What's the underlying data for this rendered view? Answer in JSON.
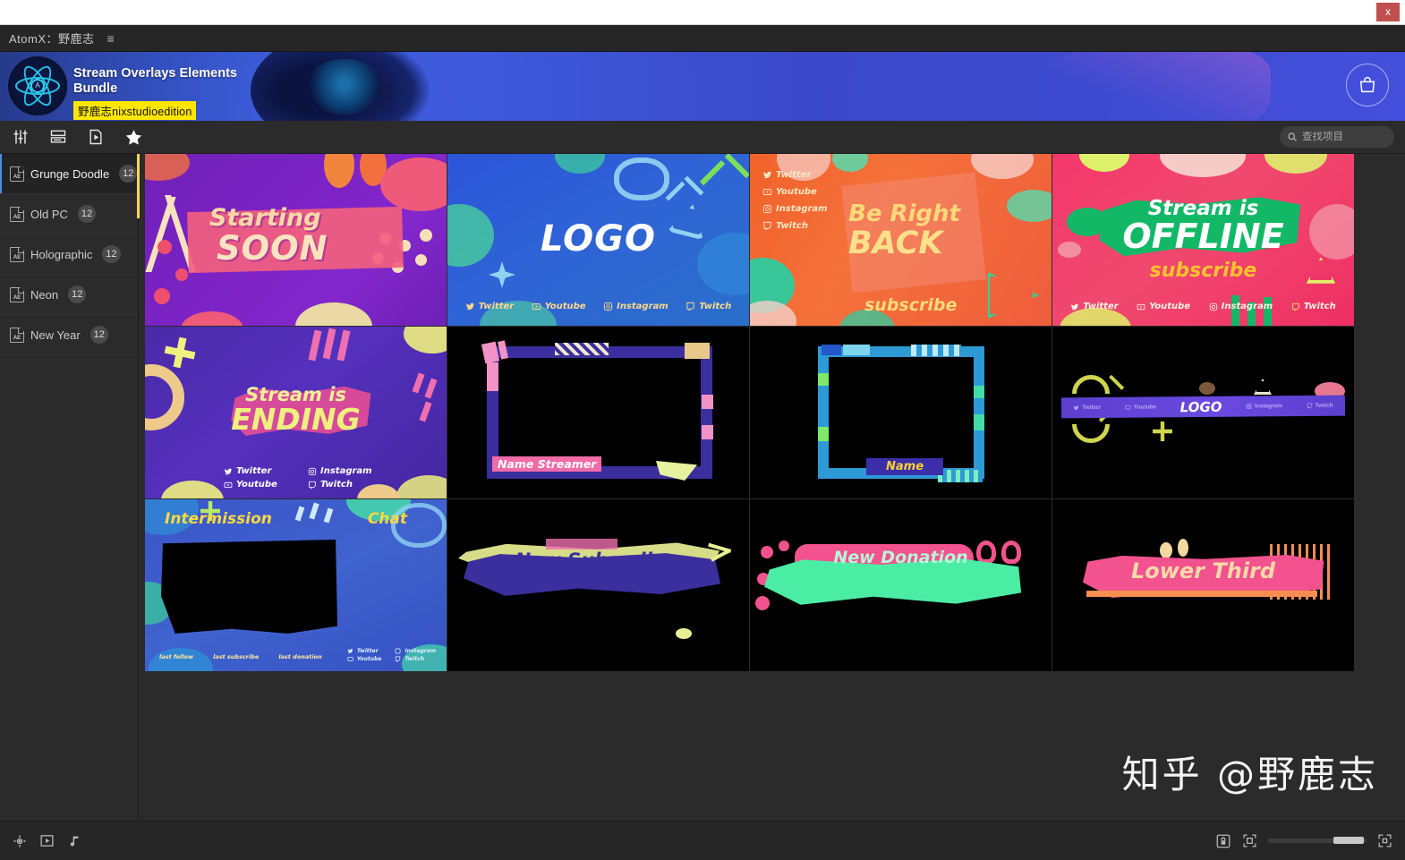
{
  "window": {
    "close_label": "x"
  },
  "menubar": {
    "title": "AtomX：野鹿志",
    "hamburger": "≡"
  },
  "hero": {
    "title": "Stream Overlays Elements Bundle",
    "tag": "野鹿志nixstudioedition",
    "logo_letter": "A",
    "cart_icon": "shopping-bag-icon"
  },
  "toolbar": {
    "icons": [
      "sliders-icon",
      "layers-icon",
      "file-play-icon",
      "star-icon"
    ]
  },
  "search": {
    "placeholder": "查找项目",
    "value": "",
    "icon": "search-icon"
  },
  "sidebar": {
    "items": [
      {
        "label": "Grunge Doodle",
        "count": "12",
        "icon": "ae-file-icon",
        "active": true
      },
      {
        "label": "Old PC",
        "count": "12",
        "icon": "ae-file-icon",
        "active": false
      },
      {
        "label": "Holographic",
        "count": "12",
        "icon": "ae-file-icon",
        "active": false
      },
      {
        "label": "Neon",
        "count": "12",
        "icon": "ae-file-icon",
        "active": false
      },
      {
        "label": "New Year",
        "count": "12",
        "icon": "ae-file-icon",
        "active": false
      }
    ]
  },
  "grid": {
    "tiles": [
      {
        "name": "starting-soon",
        "line1": "Starting",
        "line2": "SOON"
      },
      {
        "name": "logo-blue",
        "logo": "LOGO",
        "socials": [
          "Twitter",
          "Youtube",
          "Instagram",
          "Twitch"
        ]
      },
      {
        "name": "be-right-back",
        "line1": "Be Right",
        "line2": "BACK",
        "sub": "subscribe",
        "socials": [
          "Twitter",
          "Youtube",
          "Instagram",
          "Twitch"
        ]
      },
      {
        "name": "stream-offline",
        "line1": "Stream is",
        "line2": "OFFLINE",
        "sub": "subscribe",
        "socials": [
          "Twitter",
          "Youtube",
          "Instagram",
          "Twitch"
        ]
      },
      {
        "name": "stream-ending",
        "line1": "Stream is",
        "line2": "ENDING",
        "socials": [
          "Twitter",
          "Instagram",
          "Youtube",
          "Twitch"
        ]
      },
      {
        "name": "webcam-frame-purple",
        "label": "Name Streamer"
      },
      {
        "name": "webcam-frame-blue",
        "label": "Name"
      },
      {
        "name": "logo-bar",
        "logo": "LOGO",
        "socials": [
          "Twitter",
          "Youtube",
          "Instagram",
          "Twitch"
        ]
      },
      {
        "name": "intermission",
        "line1": "Intermission",
        "line2": "Chat",
        "footer": [
          "last follow",
          "last subscribe",
          "last donation"
        ],
        "socials": [
          "Twitter",
          "Instagram",
          "Youtube",
          "Twitch"
        ]
      },
      {
        "name": "new-subscriber",
        "label": "New Subscriber"
      },
      {
        "name": "new-donation",
        "label": "New Donation"
      },
      {
        "name": "lower-third",
        "label": "Lower Third"
      }
    ]
  },
  "watermark": {
    "text": "知乎 @野鹿志"
  },
  "statusbar": {
    "left_icons": [
      "target-move-icon",
      "preview-play-icon",
      "music-note-icon"
    ],
    "right_icons": [
      "lock-icon",
      "collapse-icon",
      "expand-icon"
    ],
    "zoom_percent": 75
  },
  "colors": {
    "accent_blue": "#4a90e2",
    "highlight_yellow": "#ffe600",
    "close_red": "#c0504d"
  }
}
